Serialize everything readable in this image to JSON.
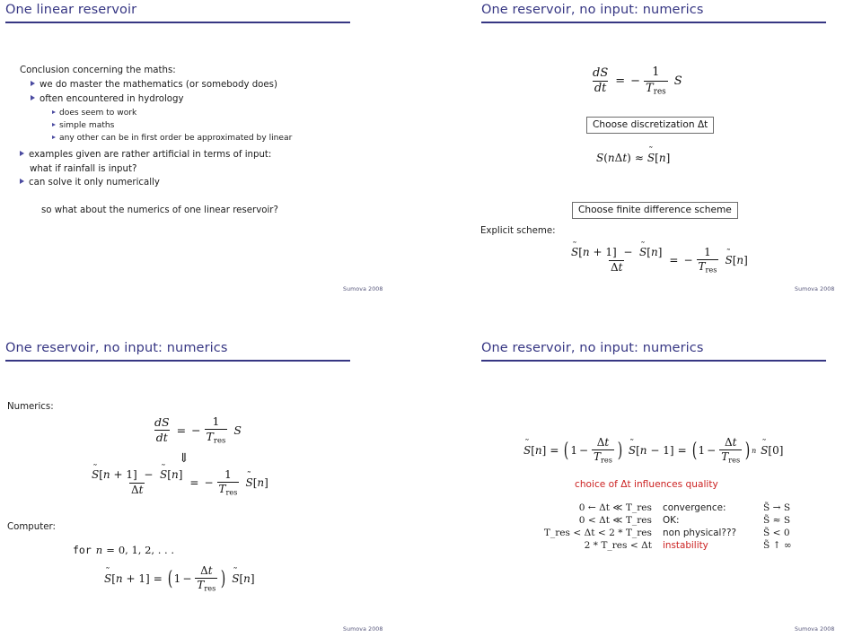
{
  "document": {
    "kind": "lecture-slide-handout",
    "slide_count": 4,
    "accent_color": "#363683",
    "emphasis_color": "#cc2222"
  },
  "slides": [
    {
      "id": "slide-1",
      "title": "One linear reservoir",
      "intro": "Conclusion concerning the maths:",
      "bullets": [
        "we do master the mathematics (or somebody does)",
        "often encountered in hydrology"
      ],
      "subbullets": [
        "does seem to work",
        "simple maths",
        "any other can be in first order be approximated by linear"
      ],
      "bullets2": [
        "examples given are rather artificial in terms of input:",
        "can solve it only numerically"
      ],
      "bullet_cont": "what if rainfall is input?",
      "closing": "so what about the numerics of one linear reservoir?",
      "footer": "Sumova 2008"
    },
    {
      "id": "slide-2",
      "title": "One reservoir, no input: numerics",
      "eq_ode": "dS/dt = -(1/T_res) S",
      "box1": "Choose discretization Δt",
      "eq_sample": "S(nΔt) ≈ S̃[n]",
      "box2": "Choose finite difference scheme",
      "scheme_label": "Explicit scheme:",
      "eq_explicit": "(S̃[n+1] - S̃[n])/Δt = -(1/T_res) S̃[n]",
      "footer": "Sumova 2008"
    },
    {
      "id": "slide-3",
      "title": "One reservoir, no input: numerics",
      "numerics_label": "Numerics:",
      "computer_label": "Computer:",
      "eq_ode": "dS/dt = -(1/T_res) S",
      "implies": "⇓",
      "eq_explicit": "(S̃[n+1] - S̃[n])/Δt = -(1/T_res) S̃[n]",
      "for_loop": "for n = 0, 1, 2, ...",
      "eq_update": "S̃[n+1] = (1 - Δt/T_res) S̃[n]",
      "footer": "Sumova 2008"
    },
    {
      "id": "slide-4",
      "title": "One reservoir, no input: numerics",
      "eq_closed": "S̃[n] = (1 - Δt/T_res) S̃[n-1] = (1 - Δt/T_res)^n S̃[0]",
      "caption": "choice of Δt influences quality",
      "stability_rows": [
        {
          "condition": "0 ← Δt ≪ T_res",
          "verdict": "convergence:",
          "verdict_red": false,
          "result": "S̃ → S"
        },
        {
          "condition": "0 < Δt ≪ T_res",
          "verdict": "OK:",
          "verdict_red": false,
          "result": "S̃ ≈ S"
        },
        {
          "condition": "T_res < Δt < 2 * T_res",
          "verdict": "non physical???",
          "verdict_red": false,
          "result": "S̃ < 0"
        },
        {
          "condition": "2 * T_res < Δt",
          "verdict": "instability",
          "verdict_red": true,
          "result": "S̃ ↑ ∞"
        }
      ],
      "footer": "Sumova 2008"
    }
  ]
}
